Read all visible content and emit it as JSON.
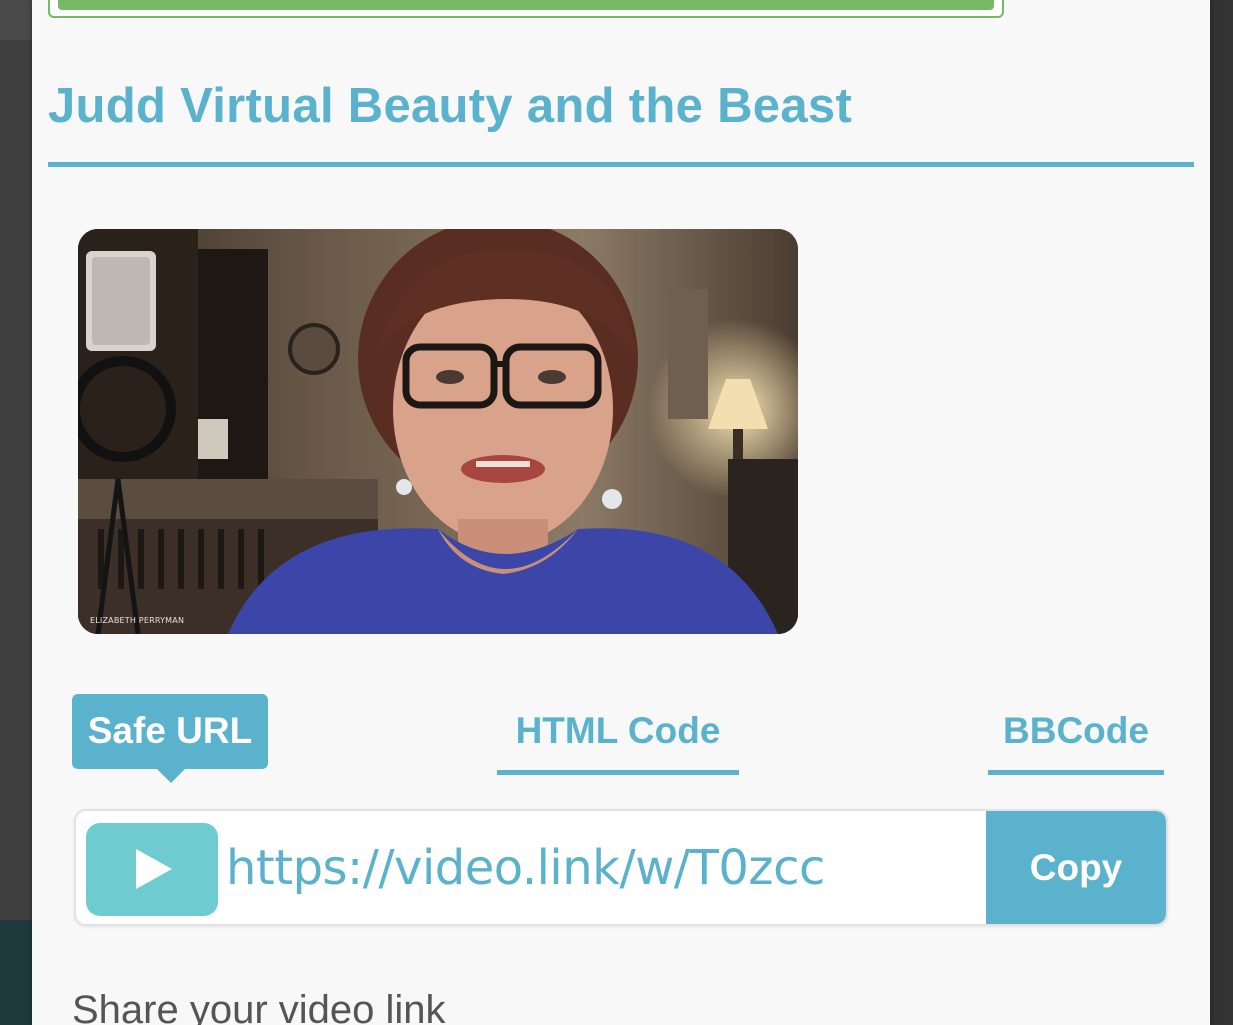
{
  "modal": {
    "title": "Judd Virtual Beauty and the Beast",
    "video": {
      "caption": "ELIZABETH PERRYMAN"
    },
    "tabs": [
      {
        "label": "Safe URL",
        "active": true
      },
      {
        "label": "HTML Code",
        "active": false
      },
      {
        "label": "BBCode",
        "active": false
      }
    ],
    "share_url": {
      "icon": "play-icon",
      "value": "https://video.link/w/T0zcc",
      "copy_label": "Copy"
    },
    "share_heading": "Share your video link"
  },
  "colors": {
    "accent": "#5ab2cc",
    "progress": "#79b865",
    "play_icon_bg": "#6ecbcf"
  }
}
